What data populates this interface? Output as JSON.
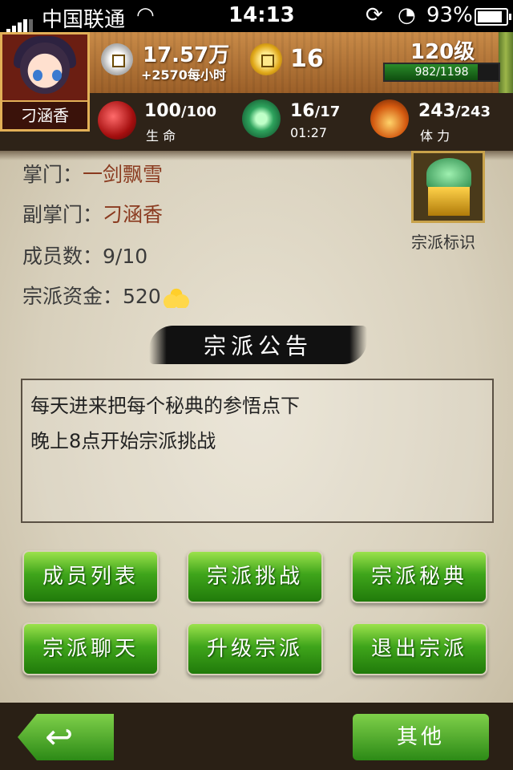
{
  "status": {
    "carrier": "中国联通",
    "time": "14:13",
    "battery": "93%"
  },
  "player": {
    "name": "刁涵香",
    "silver": "17.57万",
    "silver_rate": "+2570每小时",
    "gold": "16",
    "level": "120级",
    "exp": "982/1198",
    "exp_fraction": 0.82
  },
  "stats": {
    "hp_current": "100",
    "hp_max": "/100",
    "hp_label": "生 命",
    "energy_current": "16",
    "energy_max": "/17",
    "energy_timer": "01:27",
    "stamina_current": "243",
    "stamina_max": "/243",
    "stamina_label": "体 力"
  },
  "sect": {
    "leader_label": "掌门：",
    "leader": "一剑飘雪",
    "vice_label": "副掌门：",
    "vice": "刁涵香",
    "members_label": "成员数：",
    "members": "9/10",
    "funds_label": "宗派资金：",
    "funds": "520",
    "emblem_label": "宗派标识"
  },
  "notice": {
    "title": "宗派公告",
    "lines": [
      "每天进来把每个秘典的参悟点下",
      "晚上8点开始宗派挑战"
    ]
  },
  "buttons": {
    "member_list": "成员列表",
    "sect_challenge": "宗派挑战",
    "sect_manual": "宗派秘典",
    "sect_chat": "宗派聊天",
    "upgrade_sect": "升级宗派",
    "leave_sect": "退出宗派",
    "other": "其他"
  }
}
